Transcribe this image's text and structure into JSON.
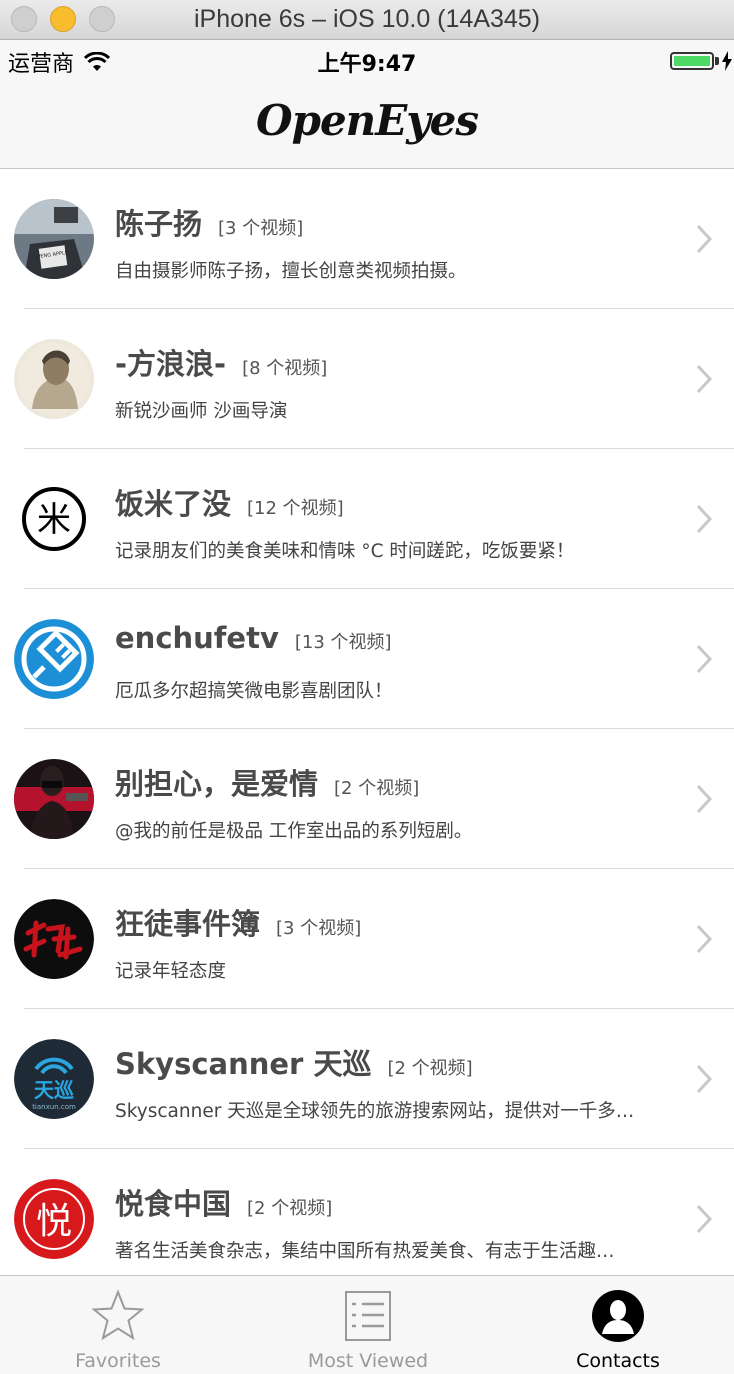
{
  "simulator": {
    "title": "iPhone 6s – iOS 10.0 (14A345)"
  },
  "status_bar": {
    "carrier": "运营商",
    "time": "上午9:47"
  },
  "navbar": {
    "title": "OpenEyes"
  },
  "authors": [
    {
      "name": "陈子扬",
      "count": "[3 个视频]",
      "desc": "自由摄影师陈子扬，擅长创意类视频拍摄。"
    },
    {
      "name": "-方浪浪-",
      "count": "[8 个视频]",
      "desc": "新锐沙画师 沙画导演"
    },
    {
      "name": "饭米了没",
      "count": "[12 个视频]",
      "desc": "记录朋友们的美食美味和情味 °C 时间蹉跎，吃饭要紧！"
    },
    {
      "name": "enchufetv",
      "count": "[13 个视频]",
      "desc": "厄瓜多尔超搞笑微电影喜剧团队！"
    },
    {
      "name": "别担心，是爱情",
      "count": "[2 个视频]",
      "desc": "@我的前任是极品 工作室出品的系列短剧。"
    },
    {
      "name": "狂徒事件簿",
      "count": "[3 个视频]",
      "desc": "记录年轻态度"
    },
    {
      "name": "Skyscanner 天巡",
      "count": "[2 个视频]",
      "desc": "Skyscanner 天巡是全球领先的旅游搜索网站，提供对一千多…"
    },
    {
      "name": "悦食中国",
      "count": "[2 个视频]",
      "desc": "著名生活美食杂志，集结中国所有热爱美食、有志于生活趣…"
    }
  ],
  "avatar_text": {
    "a1_badge": "PENG APPLE",
    "a3_glyph": "米",
    "a7_big": "天巡",
    "a7_small": "tianxun.com",
    "a8_glyph": "悦"
  },
  "tabbar": {
    "tabs": [
      {
        "label": "Favorites",
        "icon": "star-icon",
        "active": false
      },
      {
        "label": "Most Viewed",
        "icon": "list-icon",
        "active": false
      },
      {
        "label": "Contacts",
        "icon": "contacts-icon",
        "active": true
      }
    ]
  },
  "colors": {
    "battery": "#4cd964",
    "enchufe_blue": "#1d8fd6",
    "skyscanner_bg": "#1e2a36",
    "yueshi_red": "#d7191c"
  }
}
